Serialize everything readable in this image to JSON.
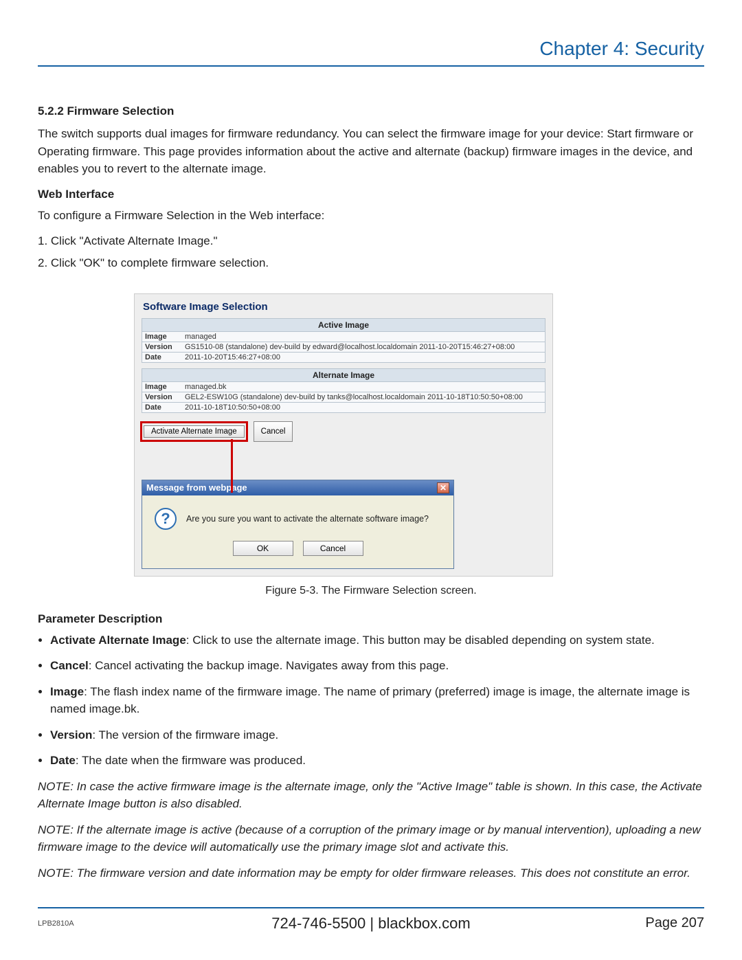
{
  "header": {
    "chapter": "Chapter 4: Security"
  },
  "section": {
    "number_title": "5.2.2 Firmware Selection",
    "intro": "The switch supports dual images for firmware redundancy. You can select the firmware image for your device: Start firmware or Operating firmware. This page provides information about the active and alternate (backup) firmware images in the device, and enables you to revert to the alternate image.",
    "web_interface_heading": "Web Interface",
    "web_interface_intro": "To configure a Firmware Selection in the Web interface:",
    "steps": [
      "1. Click \"Activate Alternate Image.\"",
      "2. Click \"OK\" to complete firmware selection."
    ]
  },
  "screenshot": {
    "panel_title": "Software Image Selection",
    "active": {
      "header": "Active Image",
      "image_label": "Image",
      "image_value": "managed",
      "version_label": "Version",
      "version_value": "GS1510-08 (standalone) dev-build by edward@localhost.localdomain 2011-10-20T15:46:27+08:00",
      "date_label": "Date",
      "date_value": "2011-10-20T15:46:27+08:00"
    },
    "alternate": {
      "header": "Alternate Image",
      "image_label": "Image",
      "image_value": "managed.bk",
      "version_label": "Version",
      "version_value": "GEL2-ESW10G (standalone) dev-build by tanks@localhost.localdomain 2011-10-18T10:50:50+08:00",
      "date_label": "Date",
      "date_value": "2011-10-18T10:50:50+08:00"
    },
    "buttons": {
      "activate": "Activate Alternate Image",
      "cancel": "Cancel"
    },
    "dialog": {
      "title": "Message from webpage",
      "message": "Are you sure you want to activate the alternate software image?",
      "ok": "OK",
      "cancel": "Cancel"
    }
  },
  "figure_caption": "Figure 5-3. The Firmware Selection screen.",
  "param_heading": "Parameter Description",
  "params": [
    {
      "term": "Activate Alternate Image",
      "desc": ": Click to use the alternate image. This button may be disabled depending on system state."
    },
    {
      "term": "Cancel",
      "desc": ": Cancel activating the backup image. Navigates away from this page."
    },
    {
      "term": "Image",
      "desc": ": The flash index name of the firmware image. The name of primary (preferred) image is image, the alternate image is named image.bk."
    },
    {
      "term": "Version",
      "desc": ": The version of the firmware image."
    },
    {
      "term": "Date",
      "desc": ": The date when the firmware was produced."
    }
  ],
  "notes": [
    "NOTE: In case the active firmware image is the alternate image, only the \"Active Image\" table is shown. In this case, the Activate Alternate Image button is also disabled.",
    "NOTE: If the alternate image is active (because of a corruption of the primary image or by manual intervention), uploading a new firmware image to the device will automatically use the primary image slot and activate this.",
    "NOTE: The firmware version and date information may be empty for older firmware releases. This does not constitute an error."
  ],
  "footer": {
    "model": "LPB2810A",
    "center": "724-746-5500   |   blackbox.com",
    "page": "Page 207"
  }
}
